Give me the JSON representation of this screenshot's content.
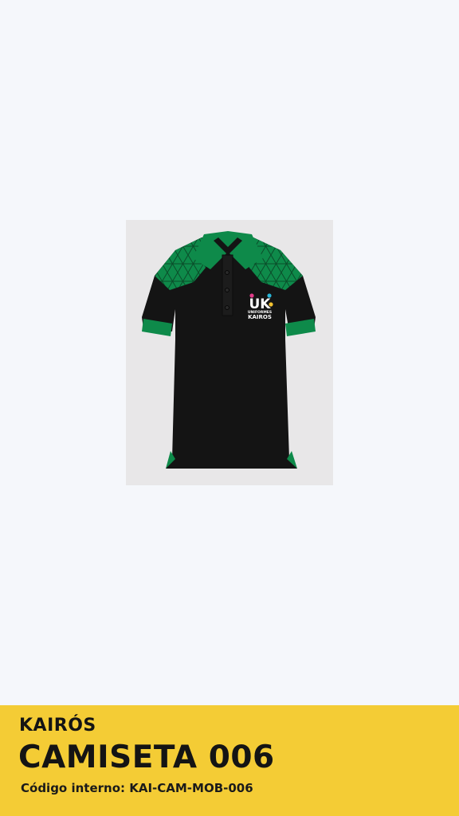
{
  "product": {
    "brand": "KAIRÓS",
    "title": "CAMISETA 006",
    "code_label": "Código interno: KAI-CAM-MOB-006"
  },
  "garment_logo": {
    "mark": "UK",
    "line1": "UNIFORMES",
    "line2": "KAIROS"
  },
  "colors": {
    "page_background": "#f5f7fb",
    "photo_background": "#e8e7e8",
    "footer_background": "#f4cc35",
    "shirt_body": "#141414",
    "shirt_accent": "#0e8a4a",
    "logo_magenta": "#e23b8a",
    "logo_yellow": "#f2c230",
    "logo_cyan": "#29b6d8"
  },
  "icons": {
    "product_image": "polo-shirt-image"
  }
}
